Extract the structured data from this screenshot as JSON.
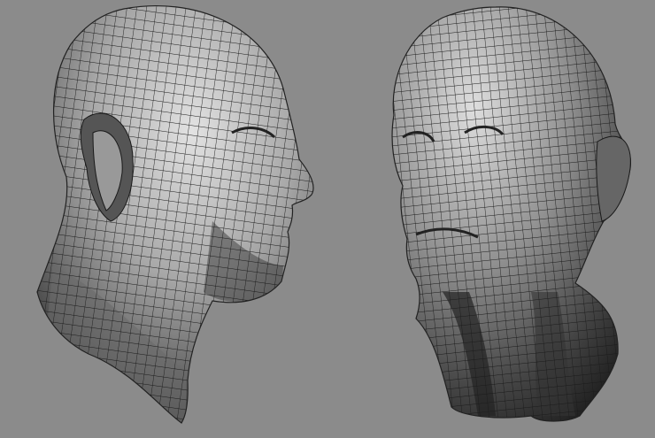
{
  "colors": {
    "background": "#8b8b8b",
    "mesh_light": "#d8d8d8",
    "mesh_dark": "#2a2a2a",
    "wire": "#1a1a1a"
  },
  "models": [
    {
      "view": "profile-right"
    },
    {
      "view": "three-quarter-left"
    }
  ]
}
